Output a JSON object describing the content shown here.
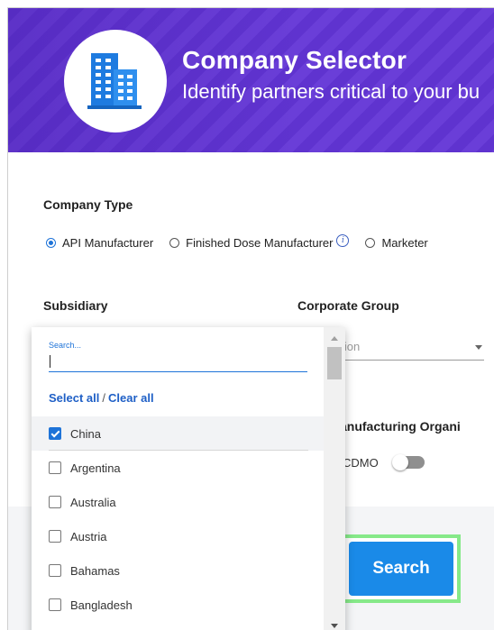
{
  "header": {
    "title": "Company Selector",
    "subtitle": "Identify partners critical to your bu",
    "logo_icon": "buildings-icon"
  },
  "colors": {
    "hero_purple": "#5f33cf",
    "accent_blue": "#1e73d8",
    "search_button": "#1a8ae8",
    "highlight_green": "#86e989"
  },
  "company_type": {
    "label": "Company Type",
    "options": [
      {
        "label": "API Manufacturer",
        "selected": true
      },
      {
        "label": "Finished Dose Manufacturer",
        "selected": false,
        "info_icon": "info-icon"
      },
      {
        "label": "Marketer",
        "selected": false
      }
    ]
  },
  "subsidiary": {
    "label": "Subsidiary"
  },
  "corporate_group": {
    "label": "Corporate Group",
    "placeholder_visible": "ation"
  },
  "cmo": {
    "label": "ct Manufacturing Organi",
    "toggle_label": "D/CDMO",
    "toggle_on": false
  },
  "dropdown": {
    "search_label": "Search...",
    "search_value": "",
    "select_all": "Select all",
    "separator": "/",
    "clear_all": "Clear all",
    "items": [
      {
        "label": "China",
        "checked": true
      },
      {
        "label": "Argentina",
        "checked": false
      },
      {
        "label": "Australia",
        "checked": false
      },
      {
        "label": "Austria",
        "checked": false
      },
      {
        "label": "Bahamas",
        "checked": false
      },
      {
        "label": "Bangladesh",
        "checked": false
      }
    ]
  },
  "actions": {
    "search_label": "Search"
  }
}
